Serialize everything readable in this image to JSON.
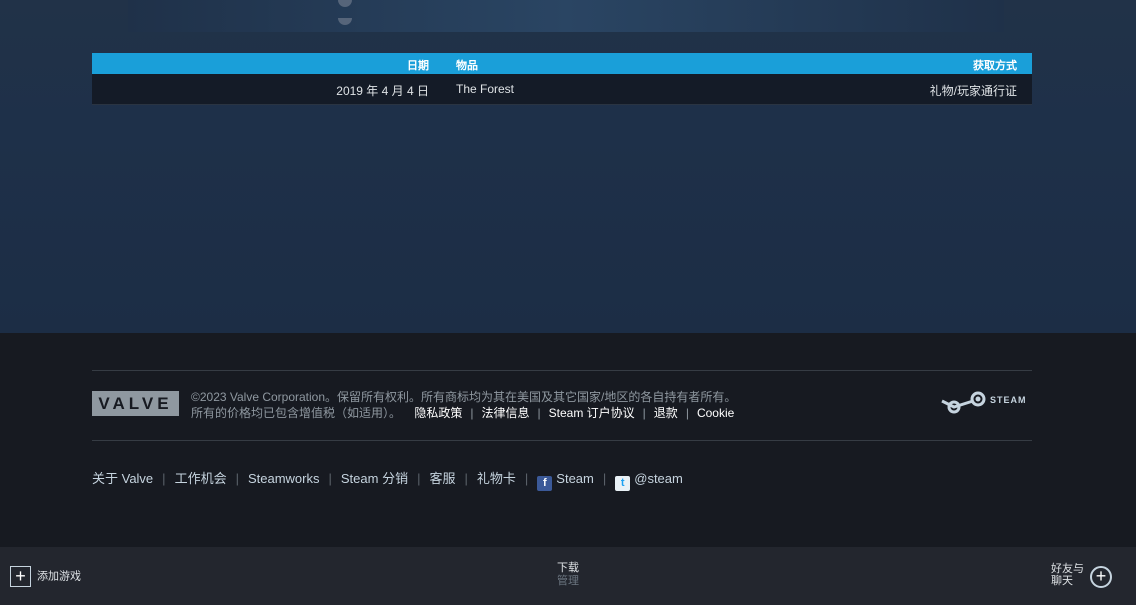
{
  "table": {
    "headers": {
      "date": "日期",
      "item": "物品",
      "method": "获取方式"
    },
    "rows": [
      {
        "date": "2019 年 4 月 4 日",
        "item": "The Forest",
        "method": "礼物/玩家通行证"
      }
    ]
  },
  "footer": {
    "valve_logo": "VALVE",
    "copyright_line1": "©2023 Valve Corporation。保留所有权利。所有商标均为其在美国及其它国家/地区的各自持有者所有。",
    "copyright_line2": "所有的价格均已包含增值税（如适用）。",
    "legal_links": [
      "隐私政策",
      "法律信息",
      "Steam 订户协议",
      "退款",
      "Cookie"
    ],
    "steam_logo_text": "STEAM",
    "links": [
      "关于 Valve",
      "工作机会",
      "Steamworks",
      "Steam 分销",
      "客服",
      "礼物卡"
    ],
    "facebook": "Steam",
    "twitter": "@steam"
  },
  "bottombar": {
    "add_game": "添加游戏",
    "downloads": "下载",
    "manage": "管理",
    "friends_line1": "好友与",
    "friends_line2": "聊天"
  },
  "colors": {
    "table_header": "#1a9fd9",
    "footer_bg": "#171a21",
    "page_bg": "#1b2838"
  }
}
